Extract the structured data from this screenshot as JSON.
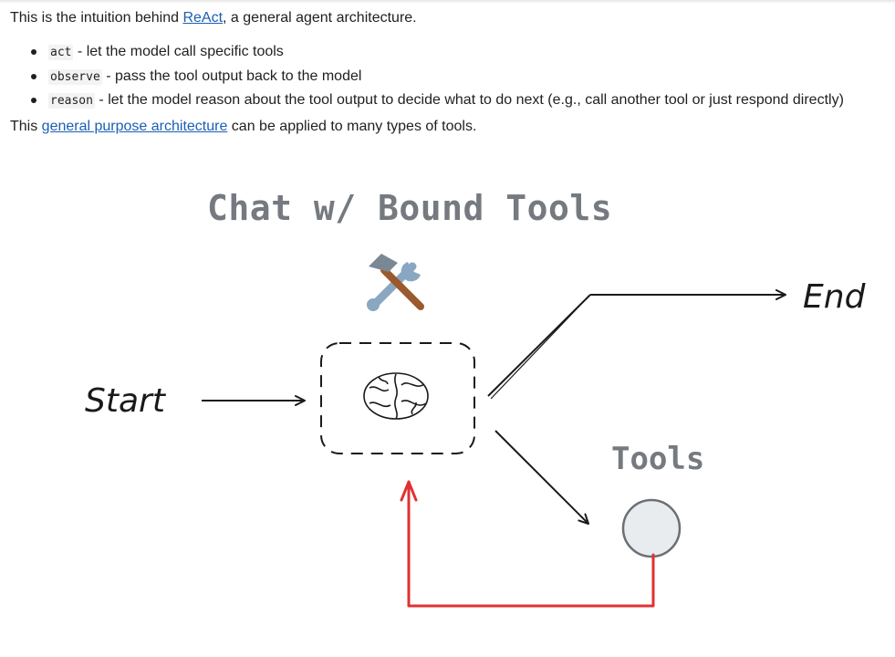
{
  "intro": {
    "prefix": "This is the intuition behind ",
    "link": "ReAct",
    "suffix": ", a general agent architecture."
  },
  "bullets": [
    {
      "code": "act",
      "text": " - let the model call specific tools"
    },
    {
      "code": "observe",
      "text": " - pass the tool output back to the model"
    },
    {
      "code": "reason",
      "text": " - let the model reason about the tool output to decide what to do next (e.g., call another tool or just respond directly)"
    }
  ],
  "outro": {
    "prefix": "This ",
    "link": "general purpose architecture",
    "suffix": " can be applied to many types of tools."
  },
  "diagram": {
    "title": "Chat w/ Bound Tools",
    "start_label": "Start",
    "end_label": "End",
    "tools_label": "Tools",
    "tools_icon": "hammer-and-wrench-icon",
    "brain_icon": "brain-icon",
    "colors": {
      "title": "#757a80",
      "loop_arrow": "#e03131",
      "tools_node_fill": "#e9ecef",
      "tools_node_stroke": "#6c6f73",
      "stroke": "#1a1a1a",
      "link": "#1a5fb4"
    }
  }
}
